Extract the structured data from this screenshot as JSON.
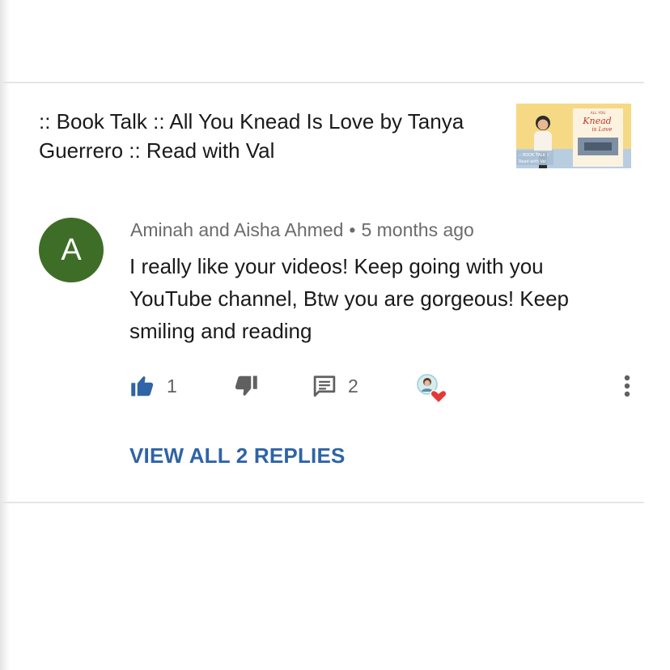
{
  "video": {
    "title": ":: Book Talk :: All You Knead Is Love by Tanya Guerrero :: Read with Val",
    "thumbnail": {
      "book_title": "All You Knead Is Love",
      "caption_line1": ":: BOOK TALK ::",
      "caption_line2": "Read with Val"
    }
  },
  "comment": {
    "avatar_letter": "A",
    "avatar_color": "#3e6d27",
    "author": "Aminah and Aisha Ahmed",
    "separator": "•",
    "time": "5 months ago",
    "text": "I really like your videos! Keep going with you YouTube channel, Btw you are gorgeous! Keep smiling and reading",
    "likes": "1",
    "replies": "2",
    "view_replies_label": "VIEW ALL 2 REPLIES"
  },
  "colors": {
    "like_active": "#2f64a6",
    "icon_gray": "#606060",
    "link_blue": "#2f64a6",
    "heart_red": "#e53935"
  },
  "icons": {
    "like": "thumbs-up-icon",
    "dislike": "thumbs-down-icon",
    "reply": "comment-icon",
    "hearted": "creator-heart-icon",
    "more": "more-vertical-icon"
  }
}
